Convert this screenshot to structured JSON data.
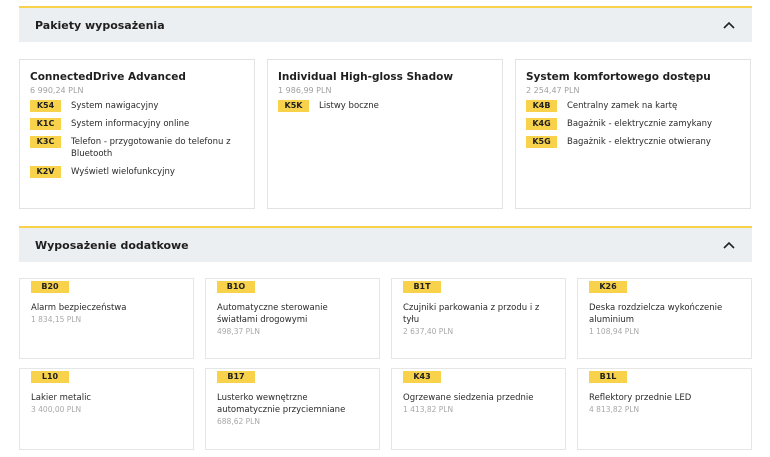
{
  "packages_section": {
    "title": "Pakiety wyposażenia",
    "collapse_icon": "chevron-up-icon",
    "packages": [
      {
        "name": "ConnectedDrive Advanced",
        "price": "6 990,24 PLN",
        "items": [
          {
            "code": "K54",
            "label": "System nawigacyjny"
          },
          {
            "code": "K1C",
            "label": "System informacyjny online"
          },
          {
            "code": "K3C",
            "label": "Telefon - przygotowanie do telefonu z Bluetooth"
          },
          {
            "code": "K2V",
            "label": "Wyświetl wielofunkcyjny"
          }
        ]
      },
      {
        "name": "Individual High-gloss Shadow",
        "price": "1 986,99 PLN",
        "items": [
          {
            "code": "K5K",
            "label": "Listwy boczne"
          }
        ]
      },
      {
        "name": "System komfortowego dostępu",
        "price": "2 254,47 PLN",
        "items": [
          {
            "code": "K4B",
            "label": "Centralny zamek na kartę"
          },
          {
            "code": "K4G",
            "label": "Bagażnik - elektrycznie zamykany"
          },
          {
            "code": "K5G",
            "label": "Bagażnik - elektrycznie otwierany"
          }
        ]
      }
    ]
  },
  "accessories_section": {
    "title": "Wyposażenie dodatkowe",
    "collapse_icon": "chevron-up-icon",
    "items": [
      {
        "code": "B20",
        "name": "Alarm bezpieczeństwa",
        "price": "1 834,15 PLN"
      },
      {
        "code": "B1O",
        "name": "Automatyczne sterowanie światłami drogowymi",
        "price": "498,37 PLN"
      },
      {
        "code": "B1T",
        "name": "Czujniki parkowania z przodu i z tyłu",
        "price": "2 637,40 PLN"
      },
      {
        "code": "K26",
        "name": "Deska rozdzielcza wykończenie aluminium",
        "price": "1 108,94 PLN"
      },
      {
        "code": "L10",
        "name": "Lakier metalic",
        "price": "3 400,00 PLN"
      },
      {
        "code": "B17",
        "name": "Lusterko wewnętrzne automatycznie przyciemniane",
        "price": "688,62 PLN"
      },
      {
        "code": "K43",
        "name": "Ogrzewane siedzenia przednie",
        "price": "1 413,82 PLN"
      },
      {
        "code": "B1L",
        "name": "Reflektory przednie LED",
        "price": "4 813,82 PLN"
      }
    ]
  },
  "colors": {
    "badge": "#f7d24a",
    "header_bg": "#eceff1",
    "price_text": "#a0a0a0"
  }
}
